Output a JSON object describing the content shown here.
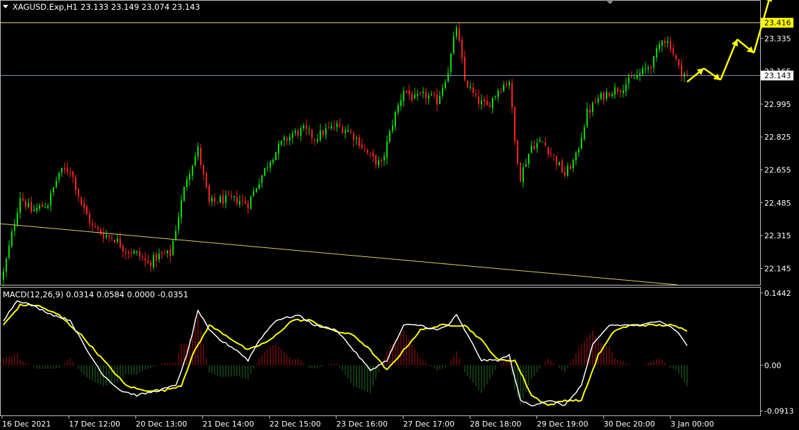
{
  "header": {
    "symbol_timeframe": "XAGUSD.Exp,H1",
    "ohlc": "23.133 23.149 23.074 23.143"
  },
  "indicator": {
    "label": "MACD(12,26,9) 0.0314 0.0584 0.0000 -0.0351"
  },
  "colors": {
    "background": "#000000",
    "bull_candle": "#00e000",
    "bear_candle": "#ff2020",
    "axis": "#c0c0c0",
    "text": "#ffffff",
    "trendline": "#d8d060",
    "price_line": "#8a9cb8",
    "hline": "#e8e070",
    "arrows": "#ffff00",
    "macd_line": "#ffffff",
    "signal_line": "#ffff00",
    "hist_pos": "#b01010",
    "hist_neg": "#207020"
  },
  "chart_data": [
    {
      "type": "candlestick",
      "symbol": "XAGUSD.Exp",
      "timeframe": "H1",
      "ylim": [
        22.06,
        23.53
      ],
      "y_ticks": [
        "23.335",
        "23.165",
        "22.995",
        "22.825",
        "22.655",
        "22.485",
        "22.315",
        "22.145"
      ],
      "x_ticks": [
        "16 Dec 2021",
        "17 Dec 12:00",
        "20 Dec 13:00",
        "21 Dec 14:00",
        "22 Dec 15:00",
        "23 Dec 16:00",
        "27 Dec 17:00",
        "28 Dec 18:00",
        "29 Dec 19:00",
        "30 Dec 20:00",
        "3 Jan 00:00"
      ],
      "current_price": "23.143",
      "level_price": "23.416",
      "close_anchors": [
        [
          0,
          22.12
        ],
        [
          3,
          22.32
        ],
        [
          6,
          22.52
        ],
        [
          10,
          22.44
        ],
        [
          16,
          22.48
        ],
        [
          20,
          22.64
        ],
        [
          24,
          22.66
        ],
        [
          28,
          22.48
        ],
        [
          32,
          22.36
        ],
        [
          36,
          22.32
        ],
        [
          40,
          22.3
        ],
        [
          44,
          22.24
        ],
        [
          48,
          22.22
        ],
        [
          52,
          22.17
        ],
        [
          56,
          22.21
        ],
        [
          60,
          22.22
        ],
        [
          63,
          22.42
        ],
        [
          66,
          22.62
        ],
        [
          70,
          22.76
        ],
        [
          74,
          22.48
        ],
        [
          78,
          22.5
        ],
        [
          84,
          22.5
        ],
        [
          88,
          22.48
        ],
        [
          92,
          22.6
        ],
        [
          96,
          22.71
        ],
        [
          100,
          22.79
        ],
        [
          104,
          22.84
        ],
        [
          108,
          22.86
        ],
        [
          112,
          22.82
        ],
        [
          116,
          22.86
        ],
        [
          120,
          22.88
        ],
        [
          124,
          22.86
        ],
        [
          128,
          22.8
        ],
        [
          132,
          22.72
        ],
        [
          136,
          22.68
        ],
        [
          140,
          22.9
        ],
        [
          144,
          23.07
        ],
        [
          148,
          23.02
        ],
        [
          152,
          23.04
        ],
        [
          156,
          23.01
        ],
        [
          160,
          23.17
        ],
        [
          163,
          23.4
        ],
        [
          166,
          23.12
        ],
        [
          170,
          23.02
        ],
        [
          174,
          22.98
        ],
        [
          178,
          23.07
        ],
        [
          182,
          23.12
        ],
        [
          184,
          22.8
        ],
        [
          186,
          22.62
        ],
        [
          190,
          22.78
        ],
        [
          194,
          22.8
        ],
        [
          198,
          22.72
        ],
        [
          202,
          22.63
        ],
        [
          206,
          22.72
        ],
        [
          210,
          22.95
        ],
        [
          214,
          23.02
        ],
        [
          218,
          23.06
        ],
        [
          222,
          23.08
        ],
        [
          226,
          23.12
        ],
        [
          230,
          23.16
        ],
        [
          234,
          23.22
        ],
        [
          237,
          23.34
        ],
        [
          240,
          23.3
        ],
        [
          243,
          23.18
        ],
        [
          246,
          23.14
        ]
      ],
      "projection_arrows": [
        [
          [
            246,
            23.11
          ],
          [
            252,
            23.18
          ],
          [
            258,
            23.12
          ],
          [
            264,
            23.33
          ],
          [
            270,
            23.26
          ],
          [
            276,
            23.56
          ]
        ]
      ]
    },
    {
      "type": "macd",
      "params": [
        12,
        26,
        9
      ],
      "ylim": [
        -0.1,
        0.155
      ],
      "y_ticks": [
        "0.1442",
        "0.00",
        "-0.0913"
      ],
      "macd_anchors": [
        [
          0,
          0.09
        ],
        [
          5,
          0.13
        ],
        [
          10,
          0.12
        ],
        [
          18,
          0.1
        ],
        [
          24,
          0.09
        ],
        [
          30,
          0.03
        ],
        [
          36,
          -0.02
        ],
        [
          42,
          -0.05
        ],
        [
          48,
          -0.06
        ],
        [
          56,
          -0.05
        ],
        [
          62,
          -0.04
        ],
        [
          66,
          0.02
        ],
        [
          70,
          0.11
        ],
        [
          74,
          0.07
        ],
        [
          78,
          0.05
        ],
        [
          84,
          0.03
        ],
        [
          88,
          0.01
        ],
        [
          92,
          0.05
        ],
        [
          98,
          0.09
        ],
        [
          106,
          0.1
        ],
        [
          112,
          0.08
        ],
        [
          120,
          0.07
        ],
        [
          126,
          0.03
        ],
        [
          132,
          -0.01
        ],
        [
          138,
          0.01
        ],
        [
          144,
          0.08
        ],
        [
          150,
          0.08
        ],
        [
          156,
          0.07
        ],
        [
          160,
          0.08
        ],
        [
          163,
          0.1
        ],
        [
          166,
          0.07
        ],
        [
          172,
          0.01
        ],
        [
          178,
          0.01
        ],
        [
          182,
          0.02
        ],
        [
          186,
          -0.07
        ],
        [
          190,
          -0.08
        ],
        [
          196,
          -0.07
        ],
        [
          202,
          -0.08
        ],
        [
          208,
          -0.04
        ],
        [
          212,
          0.04
        ],
        [
          218,
          0.08
        ],
        [
          224,
          0.08
        ],
        [
          230,
          0.08
        ],
        [
          236,
          0.09
        ],
        [
          242,
          0.07
        ],
        [
          246,
          0.04
        ]
      ],
      "signal_anchors": [
        [
          0,
          0.08
        ],
        [
          6,
          0.12
        ],
        [
          12,
          0.12
        ],
        [
          20,
          0.1
        ],
        [
          28,
          0.06
        ],
        [
          36,
          0.01
        ],
        [
          44,
          -0.04
        ],
        [
          50,
          -0.05
        ],
        [
          58,
          -0.05
        ],
        [
          64,
          -0.04
        ],
        [
          68,
          0.02
        ],
        [
          74,
          0.08
        ],
        [
          80,
          0.06
        ],
        [
          88,
          0.03
        ],
        [
          96,
          0.05
        ],
        [
          104,
          0.09
        ],
        [
          110,
          0.09
        ],
        [
          118,
          0.07
        ],
        [
          126,
          0.06
        ],
        [
          132,
          0.03
        ],
        [
          138,
          -0.01
        ],
        [
          144,
          0.03
        ],
        [
          150,
          0.07
        ],
        [
          158,
          0.08
        ],
        [
          166,
          0.08
        ],
        [
          172,
          0.05
        ],
        [
          178,
          0.01
        ],
        [
          184,
          0.01
        ],
        [
          190,
          -0.06
        ],
        [
          196,
          -0.08
        ],
        [
          202,
          -0.07
        ],
        [
          208,
          -0.07
        ],
        [
          214,
          0.02
        ],
        [
          220,
          0.07
        ],
        [
          226,
          0.08
        ],
        [
          232,
          0.08
        ],
        [
          240,
          0.08
        ],
        [
          246,
          0.07
        ]
      ]
    }
  ]
}
